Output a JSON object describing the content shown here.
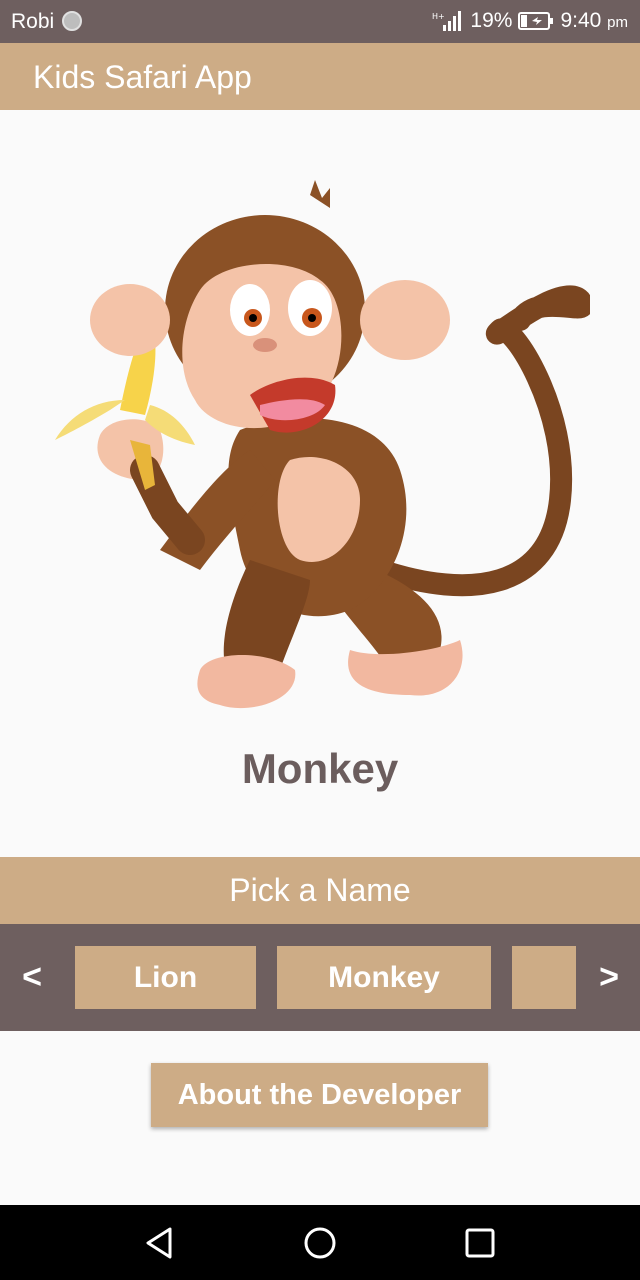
{
  "status_bar": {
    "carrier": "Robi",
    "battery": "19%",
    "time": "9:40",
    "time_suffix": "pm"
  },
  "app_bar": {
    "title": "Kids Safari App"
  },
  "animal": {
    "name": "Monkey",
    "image": "monkey-holding-banana"
  },
  "picker": {
    "header": "Pick a Name",
    "prev": "<",
    "next": ">",
    "options": [
      "Lion",
      "Monkey",
      ""
    ]
  },
  "about_button": "About the Developer",
  "colors": {
    "accent": "#cdac86",
    "dark": "#6e5f5f",
    "name_text": "#6b5d5d",
    "background": "#fafafa"
  },
  "icons": [
    "sync-icon",
    "signal-icon",
    "battery-icon",
    "back-icon",
    "home-icon",
    "recent-apps-icon"
  ]
}
